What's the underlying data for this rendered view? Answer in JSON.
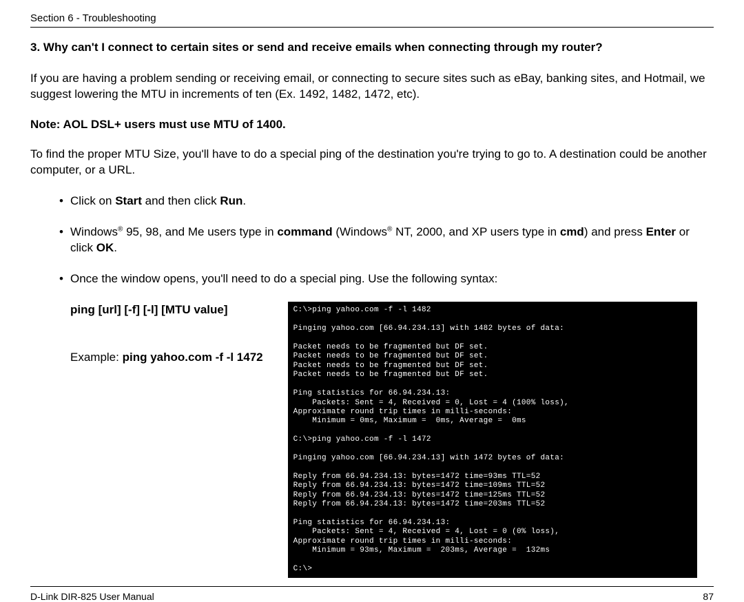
{
  "header": {
    "section": "Section 6 - Troubleshooting"
  },
  "question": "3. Why can't I connect to certain sites or send and receive emails when connecting through my router?",
  "p1": "If you are having a problem sending or receiving email, or connecting to secure sites such as eBay, banking sites, and Hotmail, we suggest lowering the MTU in increments of ten (Ex. 1492, 1482, 1472, etc).",
  "note": "Note: AOL DSL+ users must use MTU of 1400.",
  "p2": "To find the proper MTU Size, you'll have to do a special ping of the destination you're trying to go to. A destination could be another computer, or a URL.",
  "bullets": {
    "b1_a": "Click on ",
    "b1_b": "Start",
    "b1_c": " and then click ",
    "b1_d": "Run",
    "b1_e": ".",
    "b2_a": "Windows",
    "b2_b": " 95, 98, and Me users type in ",
    "b2_c": "command",
    "b2_d": " (Windows",
    "b2_e": " NT, 2000, and XP users type in ",
    "b2_f": "cmd",
    "b2_g": ") and press ",
    "b2_h": "Enter",
    "b2_i": " or click ",
    "b2_j": "OK",
    "b2_k": ".",
    "b3": "Once the window opens, you'll need to do a special ping. Use the following syntax:"
  },
  "syntax": "ping [url] [-f] [-l] [MTU value]",
  "example_a": "Example: ",
  "example_b": "ping yahoo.com -f -l 1472",
  "terminal": "C:\\>ping yahoo.com -f -l 1482\n\nPinging yahoo.com [66.94.234.13] with 1482 bytes of data:\n\nPacket needs to be fragmented but DF set.\nPacket needs to be fragmented but DF set.\nPacket needs to be fragmented but DF set.\nPacket needs to be fragmented but DF set.\n\nPing statistics for 66.94.234.13:\n    Packets: Sent = 4, Received = 0, Lost = 4 (100% loss),\nApproximate round trip times in milli-seconds:\n    Minimum = 0ms, Maximum =  0ms, Average =  0ms\n\nC:\\>ping yahoo.com -f -l 1472\n\nPinging yahoo.com [66.94.234.13] with 1472 bytes of data:\n\nReply from 66.94.234.13: bytes=1472 time=93ms TTL=52\nReply from 66.94.234.13: bytes=1472 time=109ms TTL=52\nReply from 66.94.234.13: bytes=1472 time=125ms TTL=52\nReply from 66.94.234.13: bytes=1472 time=203ms TTL=52\n\nPing statistics for 66.94.234.13:\n    Packets: Sent = 4, Received = 4, Lost = 0 (0% loss),\nApproximate round trip times in milli-seconds:\n    Minimum = 93ms, Maximum =  203ms, Average =  132ms\n\nC:\\>",
  "footer": {
    "left": "D-Link DIR-825 User Manual",
    "right": "87"
  }
}
